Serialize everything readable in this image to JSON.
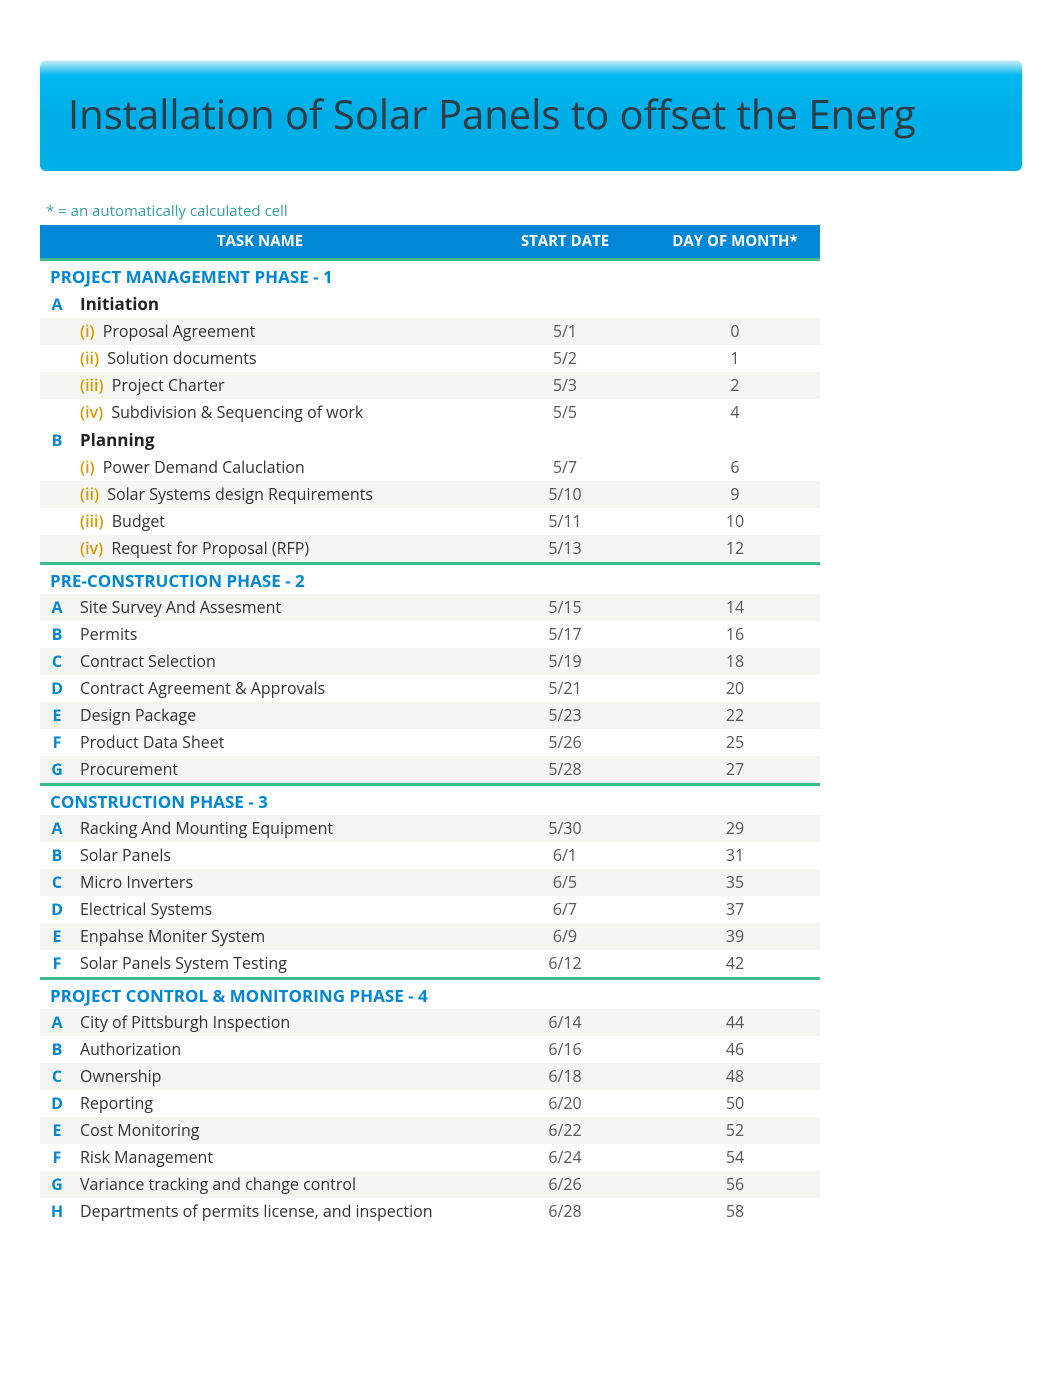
{
  "title": "Installation of Solar Panels to offset the Energ",
  "note": "* = an automatically calculated cell",
  "columns": {
    "task": "TASK NAME",
    "start": "START DATE",
    "day": "DAY OF MONTH*"
  },
  "phases": [
    {
      "title": "PROJECT MANAGEMENT PHASE - 1",
      "groups": [
        {
          "marker": "A",
          "heading": "Initiation",
          "rows": [
            {
              "roman": "(i)",
              "task": "Proposal Agreement",
              "start": "5/1",
              "day": "0",
              "alt": true
            },
            {
              "roman": "(ii)",
              "task": "Solution documents",
              "start": "5/2",
              "day": "1",
              "alt": false
            },
            {
              "roman": "(iii)",
              "task": "Project Charter",
              "start": "5/3",
              "day": "2",
              "alt": true
            },
            {
              "roman": "(iv)",
              "task": "Subdivision & Sequencing of work",
              "start": "5/5",
              "day": "4",
              "alt": false
            }
          ]
        },
        {
          "marker": "B",
          "heading": "Planning",
          "rows": [
            {
              "roman": "(i)",
              "task": "Power Demand Caluclation",
              "start": "5/7",
              "day": "6",
              "alt": false
            },
            {
              "roman": "(ii)",
              "task": "Solar Systems design Requirements",
              "start": "5/10",
              "day": "9",
              "alt": true
            },
            {
              "roman": "(iii)",
              "task": "Budget",
              "start": "5/11",
              "day": "10",
              "alt": false
            },
            {
              "roman": "(iv)",
              "task": "Request for Proposal (RFP)",
              "start": "5/13",
              "day": "12",
              "alt": true
            }
          ]
        }
      ]
    },
    {
      "title": "PRE-CONSTRUCTION PHASE - 2",
      "rows": [
        {
          "marker": "A",
          "task": "Site Survey And Assesment",
          "start": "5/15",
          "day": "14",
          "alt": true
        },
        {
          "marker": "B",
          "task": "Permits",
          "start": "5/17",
          "day": "16",
          "alt": false
        },
        {
          "marker": "C",
          "task": "Contract Selection",
          "start": "5/19",
          "day": "18",
          "alt": true
        },
        {
          "marker": "D",
          "task": "Contract Agreement & Approvals",
          "start": "5/21",
          "day": "20",
          "alt": false
        },
        {
          "marker": "E",
          "task": "Design Package",
          "start": "5/23",
          "day": "22",
          "alt": true
        },
        {
          "marker": "F",
          "task": "Product Data Sheet",
          "start": "5/26",
          "day": "25",
          "alt": false
        },
        {
          "marker": "G",
          "task": "Procurement",
          "start": "5/28",
          "day": "27",
          "alt": true
        }
      ]
    },
    {
      "title": "CONSTRUCTION PHASE - 3",
      "rows": [
        {
          "marker": "A",
          "task": "Racking And Mounting Equipment",
          "start": "5/30",
          "day": "29",
          "alt": true
        },
        {
          "marker": "B",
          "task": "Solar Panels",
          "start": "6/1",
          "day": "31",
          "alt": false
        },
        {
          "marker": "C",
          "task": "Micro Inverters",
          "start": "6/5",
          "day": "35",
          "alt": true
        },
        {
          "marker": "D",
          "task": "Electrical Systems",
          "start": "6/7",
          "day": "37",
          "alt": false
        },
        {
          "marker": "E",
          "task": "Enpahse Moniter System",
          "start": "6/9",
          "day": "39",
          "alt": true
        },
        {
          "marker": "F",
          "task": "Solar Panels System Testing",
          "start": "6/12",
          "day": "42",
          "alt": false
        }
      ]
    },
    {
      "title": "PROJECT CONTROL & MONITORING PHASE - 4",
      "rows": [
        {
          "marker": "A",
          "task": "City of Pittsburgh Inspection",
          "start": "6/14",
          "day": "44",
          "alt": true
        },
        {
          "marker": "B",
          "task": "Authorization",
          "start": "6/16",
          "day": "46",
          "alt": false
        },
        {
          "marker": "C",
          "task": "Ownership",
          "start": "6/18",
          "day": "48",
          "alt": true
        },
        {
          "marker": "D",
          "task": "Reporting",
          "start": "6/20",
          "day": "50",
          "alt": false
        },
        {
          "marker": "E",
          "task": "Cost Monitoring",
          "start": "6/22",
          "day": "52",
          "alt": true
        },
        {
          "marker": "F",
          "task": "Risk Management",
          "start": "6/24",
          "day": "54",
          "alt": false
        },
        {
          "marker": "G",
          "task": "Variance tracking and change control",
          "start": "6/26",
          "day": "56",
          "alt": true
        },
        {
          "marker": "H",
          "task": "Departments of permits license, and inspection",
          "start": "6/28",
          "day": "58",
          "alt": false
        }
      ]
    }
  ]
}
